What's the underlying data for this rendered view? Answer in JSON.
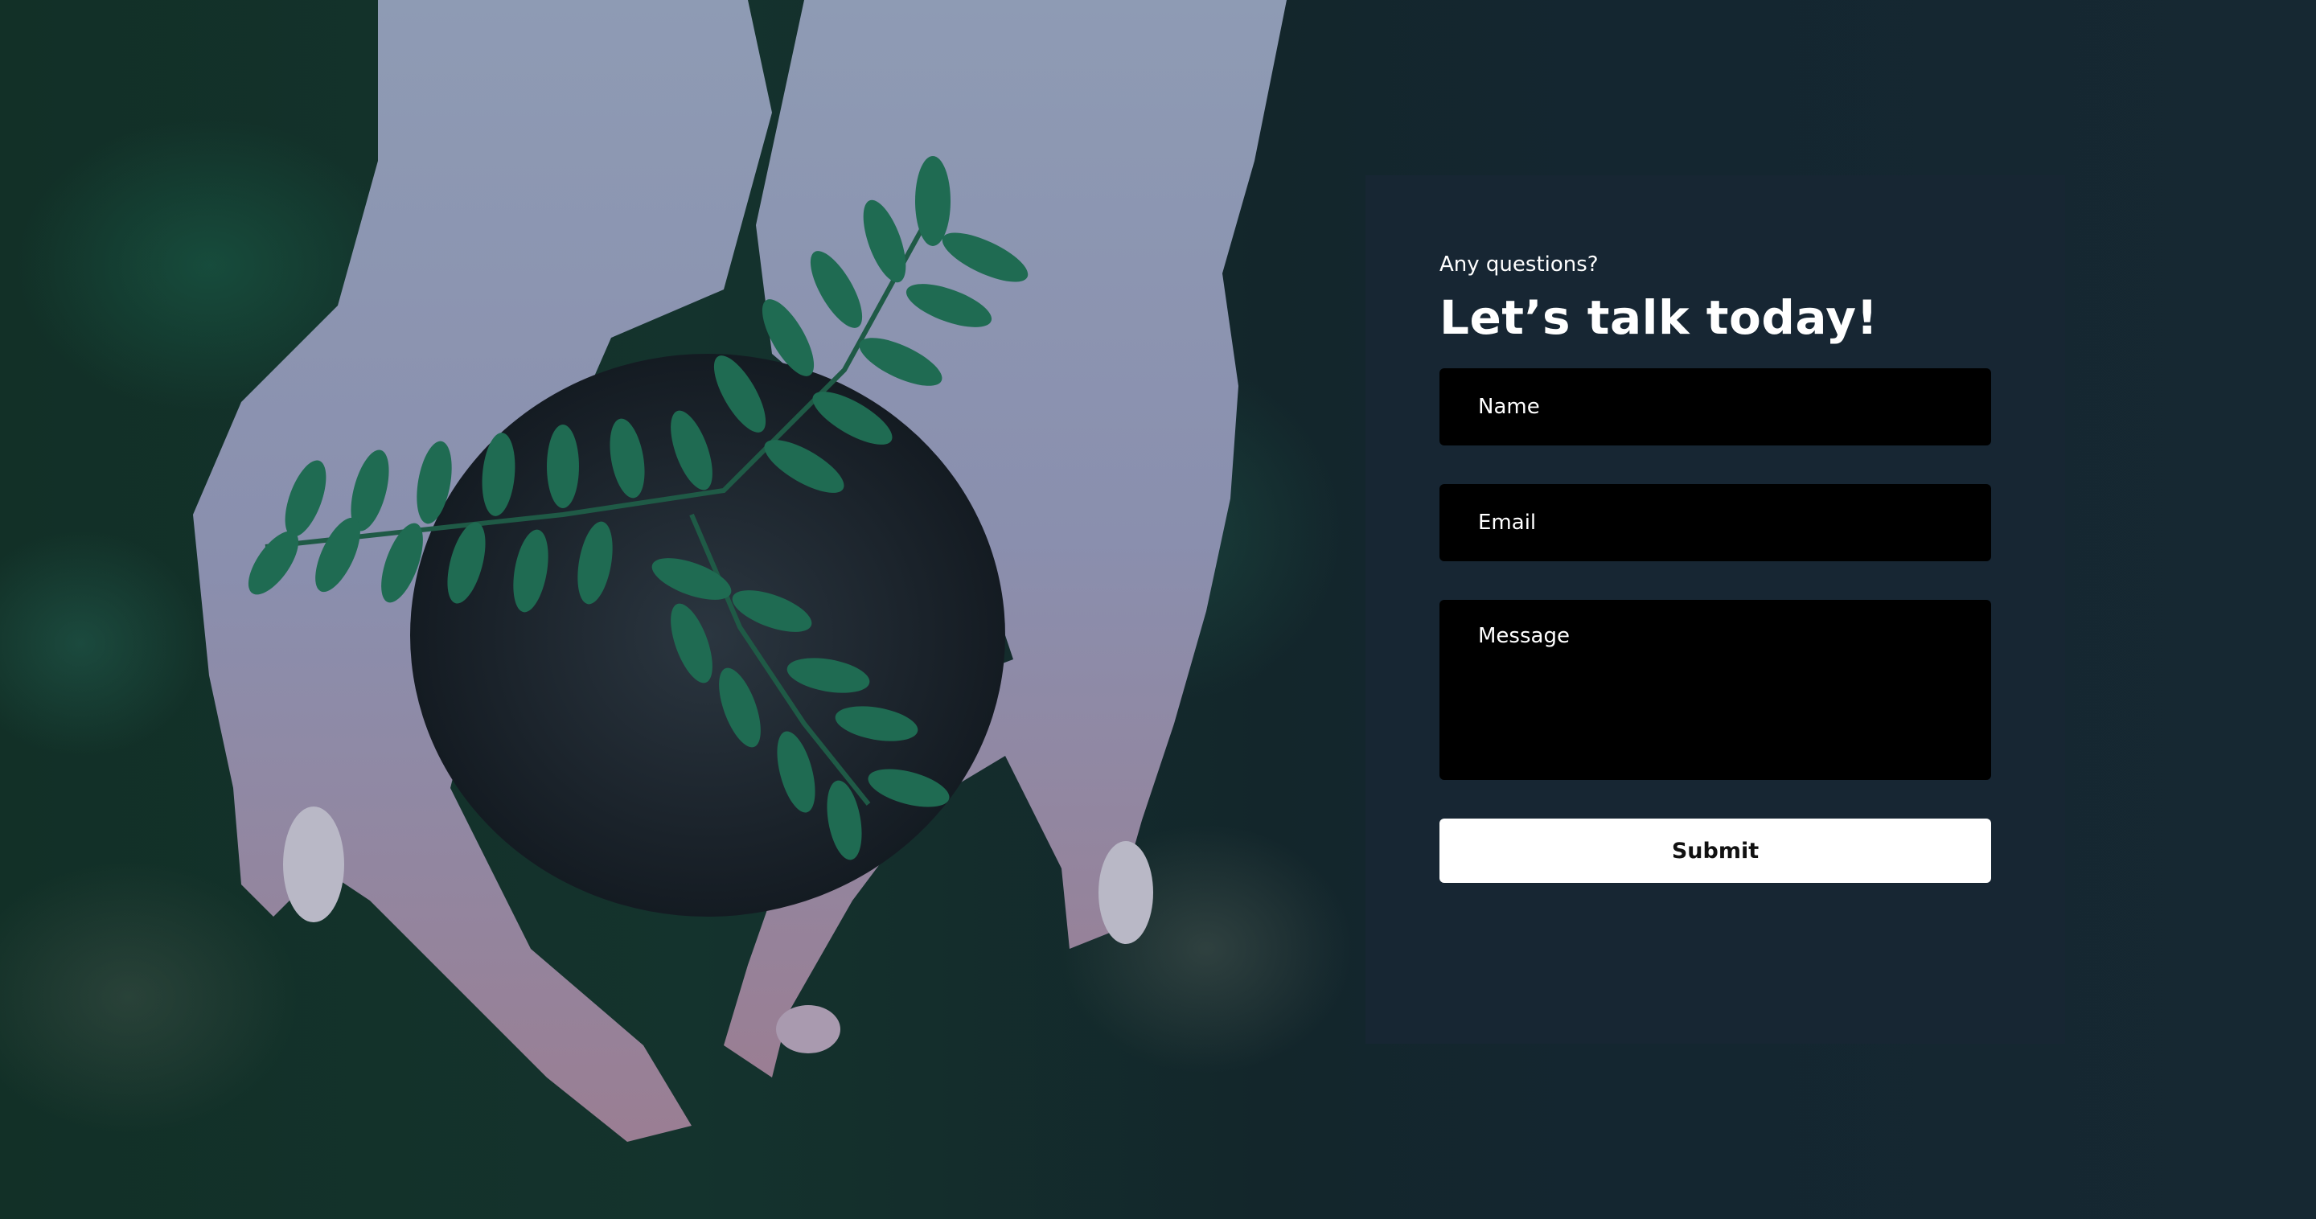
{
  "contact": {
    "eyebrow": "Any questions?",
    "headline": "Let’s talk today!",
    "fields": {
      "name_placeholder": "Name",
      "email_placeholder": "Email",
      "message_placeholder": "Message"
    },
    "submit_label": "Submit"
  },
  "colors": {
    "card_background": "#172633",
    "input_background": "#000000",
    "button_background": "#ffffff",
    "text_light": "#ffffff"
  },
  "background_image": "hands-holding-soil-with-seedling"
}
